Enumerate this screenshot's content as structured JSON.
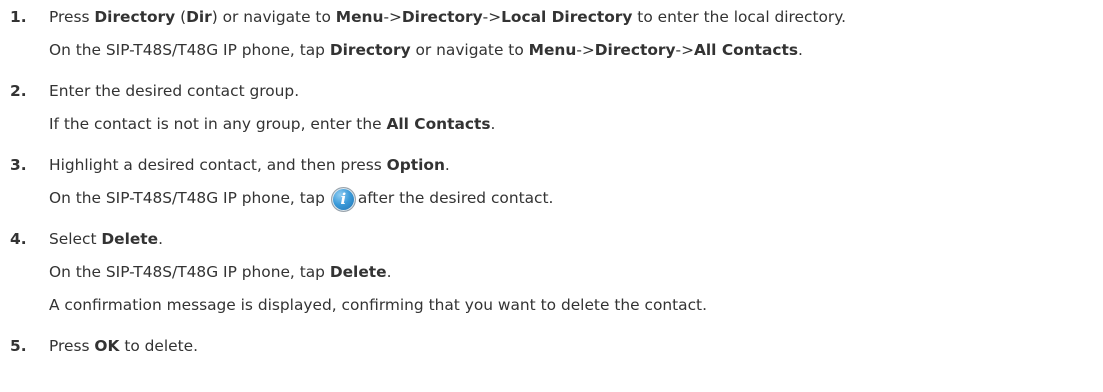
{
  "steps": [
    {
      "number": "1.",
      "main": {
        "t1": "Press ",
        "b1": "Directory",
        "t2": " (",
        "b2": "Dir",
        "t3": ") or navigate to ",
        "b3": "Menu",
        "t4": "->",
        "b4": "Directory",
        "t5": "->",
        "b5": "Local Directory",
        "t6": " to enter the local directory."
      },
      "sub": [
        {
          "t1": "On the SIP-T48S/T48G IP phone, tap ",
          "b1": "Directory",
          "t2": " or navigate to ",
          "b2": "Menu",
          "t3": "->",
          "b3": "Directory",
          "t4": "->",
          "b4": "All Contacts",
          "t5": "."
        }
      ]
    },
    {
      "number": "2.",
      "main": {
        "t1": "Enter the desired contact group."
      },
      "sub": [
        {
          "t1": "If the contact is not in any group, enter the ",
          "b1": "All Contacts",
          "t2": "."
        }
      ]
    },
    {
      "number": "3.",
      "main": {
        "t1": "Highlight a desired contact, and then press ",
        "b1": "Option",
        "t2": "."
      },
      "sub": [
        {
          "t1": "On the SIP-T48S/T48G IP phone, tap ",
          "icon": "info-icon",
          "icon_glyph": "i",
          "t2": "after the desired contact."
        }
      ]
    },
    {
      "number": "4.",
      "main": {
        "t1": "Select ",
        "b1": "Delete",
        "t2": "."
      },
      "sub": [
        {
          "t1": "On the SIP-T48S/T48G IP phone, tap ",
          "b1": "Delete",
          "t2": "."
        },
        {
          "t1": "A confirmation message is displayed, confirming that you want to delete the contact."
        }
      ]
    },
    {
      "number": "5.",
      "main": {
        "t1": "Press ",
        "b1": "OK",
        "t2": " to delete."
      },
      "sub": []
    }
  ]
}
